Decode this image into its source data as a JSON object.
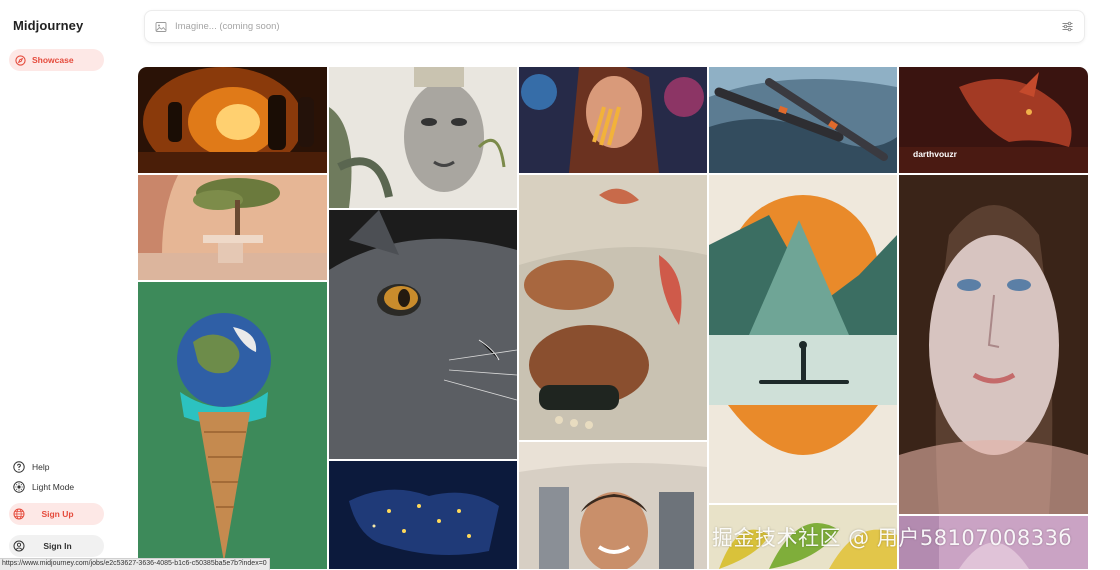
{
  "app": {
    "name": "Midjourney"
  },
  "nav": {
    "showcase": {
      "label": "Showcase",
      "icon": "compass-icon"
    }
  },
  "sidebar_bottom": {
    "help": {
      "label": "Help",
      "icon": "help-circle-icon"
    },
    "light_mode": {
      "label": "Light Mode",
      "icon": "sun-icon"
    },
    "sign_up": {
      "label": "Sign Up",
      "icon": "globe-icon"
    },
    "sign_in": {
      "label": "Sign In",
      "icon": "user-circle-icon"
    }
  },
  "search": {
    "placeholder": "Imagine... (coming soon)",
    "icon": "image-icon",
    "filter_icon": "sliders-icon"
  },
  "gallery": {
    "tiles": [
      {
        "name": "firefighters-tunnel-image"
      },
      {
        "name": "collage-woman-face-image"
      },
      {
        "name": "woman-eating-fries-image"
      },
      {
        "name": "spaceships-image"
      },
      {
        "name": "red-dragon-image",
        "caption": "darthvouzr"
      },
      {
        "name": "interior-tree-room-image"
      },
      {
        "name": "gray-cat-closeup-image"
      },
      {
        "name": "embroidered-birds-hands-image"
      },
      {
        "name": "mountain-lake-paddleboard-image"
      },
      {
        "name": "glowing-face-portrait-image"
      },
      {
        "name": "earth-ice-cream-cone-image"
      },
      {
        "name": "europe-night-map-image"
      },
      {
        "name": "smiling-man-cafe-image"
      },
      {
        "name": "ginkgo-leaves-image"
      },
      {
        "name": "pink-figure-image"
      }
    ]
  },
  "status_bar": {
    "url": "https://www.midjourney.com/jobs/e2c53627-3636-4085-b1c6-c50385ba5e7b?index=0"
  },
  "watermark": {
    "text": "掘金技术社区 @ 用户5810700833б"
  },
  "colors": {
    "accent": "#e54b3c",
    "accent_bg": "#fde8e6"
  }
}
